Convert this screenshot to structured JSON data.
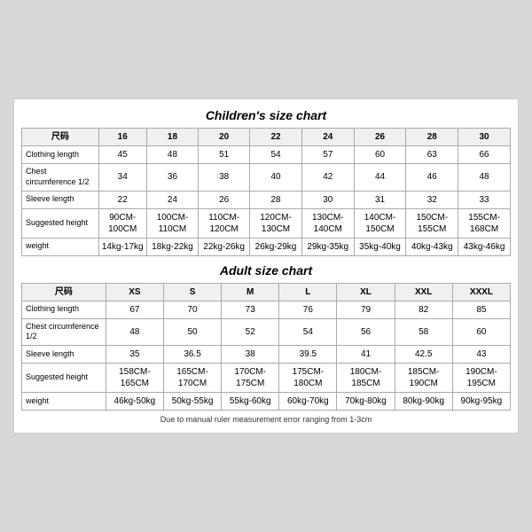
{
  "children_chart": {
    "title": "Children's size chart",
    "headers": [
      "尺码",
      "16",
      "18",
      "20",
      "22",
      "24",
      "26",
      "28",
      "30"
    ],
    "rows": [
      {
        "label": "Clothing length",
        "values": [
          "45",
          "48",
          "51",
          "54",
          "57",
          "60",
          "63",
          "66"
        ]
      },
      {
        "label": "Chest circumference 1/2",
        "values": [
          "34",
          "36",
          "38",
          "40",
          "42",
          "44",
          "46",
          "48"
        ]
      },
      {
        "label": "Sleeve length",
        "values": [
          "22",
          "24",
          "26",
          "28",
          "30",
          "31",
          "32",
          "33"
        ]
      },
      {
        "label": "Suggested height",
        "values": [
          "90CM-100CM",
          "100CM-110CM",
          "110CM-120CM",
          "120CM-130CM",
          "130CM-140CM",
          "140CM-150CM",
          "150CM-155CM",
          "155CM-168CM"
        ]
      },
      {
        "label": "weight",
        "values": [
          "14kg-17kg",
          "18kg-22kg",
          "22kg-26kg",
          "26kg-29kg",
          "29kg-35kg",
          "35kg-40kg",
          "40kg-43kg",
          "43kg-46kg"
        ]
      }
    ]
  },
  "adult_chart": {
    "title": "Adult size chart",
    "headers": [
      "尺码",
      "XS",
      "S",
      "M",
      "L",
      "XL",
      "XXL",
      "XXXL"
    ],
    "rows": [
      {
        "label": "Clothing length",
        "values": [
          "67",
          "70",
          "73",
          "76",
          "79",
          "82",
          "85"
        ]
      },
      {
        "label": "Chest circumference 1/2",
        "values": [
          "48",
          "50",
          "52",
          "54",
          "56",
          "58",
          "60"
        ]
      },
      {
        "label": "Sleeve length",
        "values": [
          "35",
          "36.5",
          "38",
          "39.5",
          "41",
          "42.5",
          "43"
        ]
      },
      {
        "label": "Suggested height",
        "values": [
          "158CM-165CM",
          "165CM-170CM",
          "170CM-175CM",
          "175CM-180CM",
          "180CM-185CM",
          "185CM-190CM",
          "190CM-195CM"
        ]
      },
      {
        "label": "weight",
        "values": [
          "46kg-50kg",
          "50kg-55kg",
          "55kg-60kg",
          "60kg-70kg",
          "70kg-80kg",
          "80kg-90kg",
          "90kg-95kg"
        ]
      }
    ]
  },
  "footer_note": "Due to manual ruler measurement error ranging from 1-3cm"
}
